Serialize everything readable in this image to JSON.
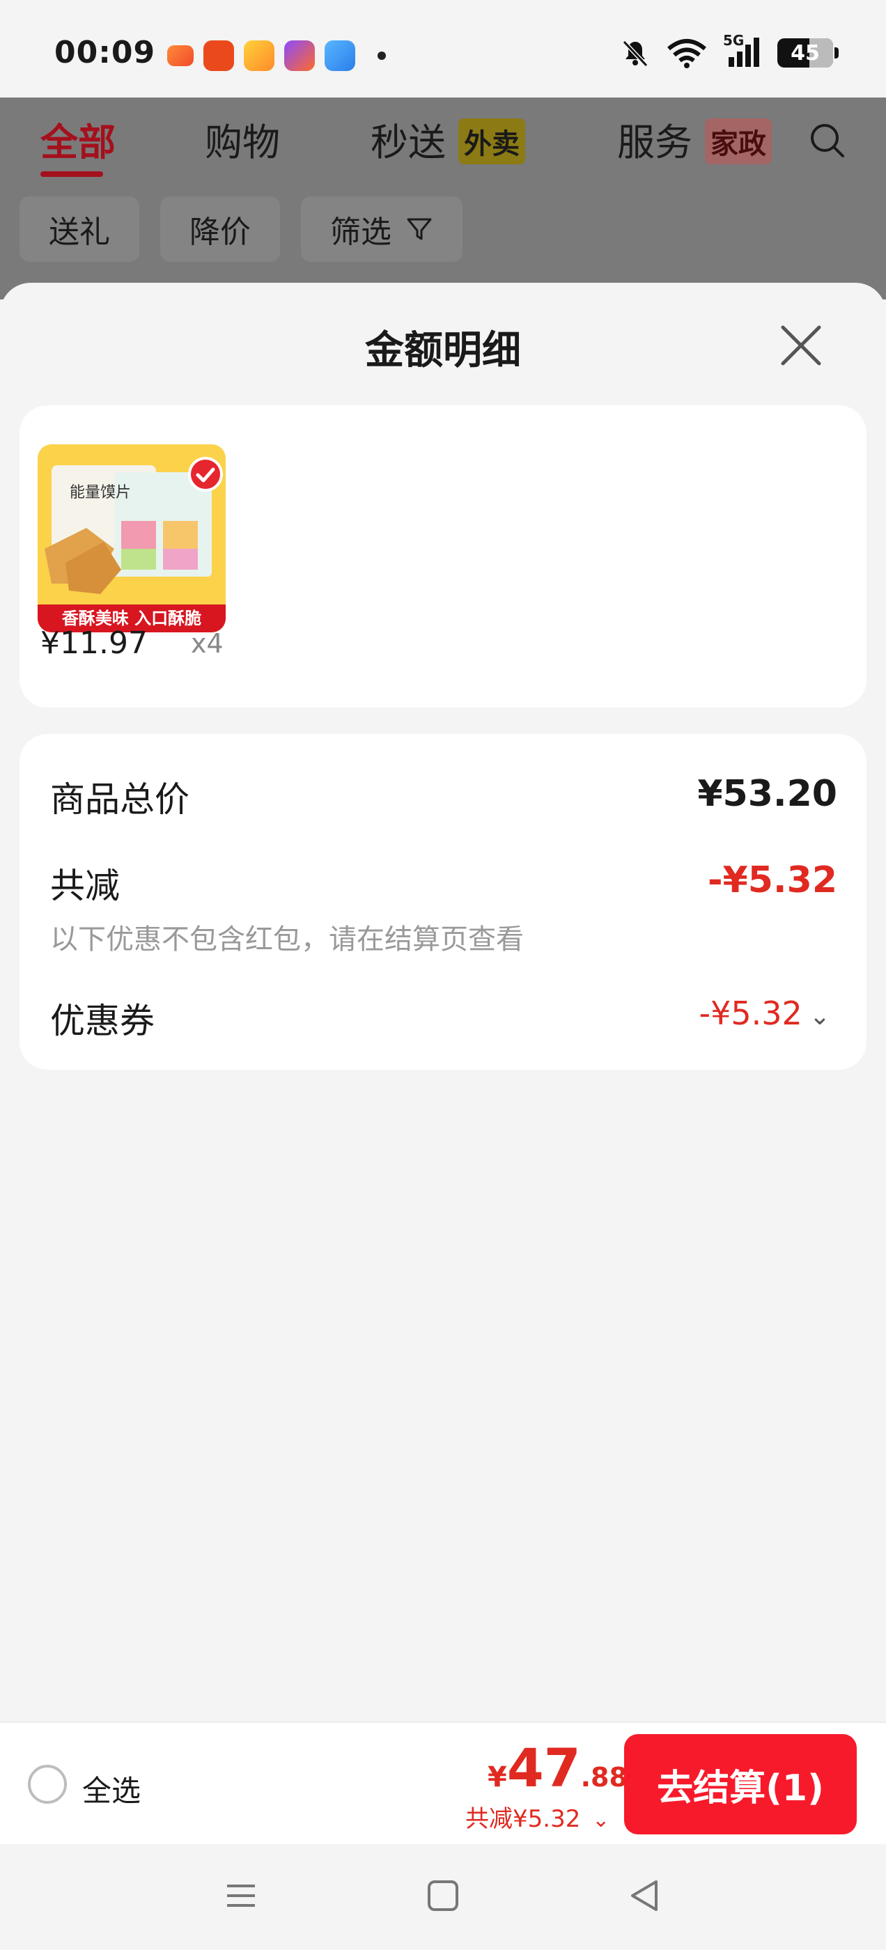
{
  "status_bar": {
    "time": "00:09",
    "network": "5G",
    "battery": "45"
  },
  "background_header": {
    "tabs": [
      {
        "label": "全部"
      },
      {
        "label": "购物"
      },
      {
        "label": "秒送",
        "badge": "外卖"
      },
      {
        "label": "服务",
        "badge": "家政"
      }
    ],
    "chips": [
      "送礼",
      "降价",
      "筛选"
    ]
  },
  "sheet": {
    "title": "金额明细",
    "product": {
      "image_caption": "香酥美味 入口酥脆",
      "image_brand": "能量馍片",
      "price": "¥11.97",
      "quantity": "x4"
    },
    "summary": {
      "total_label": "商品总价",
      "total_value": "¥53.20",
      "discount_label": "共减",
      "discount_value": "-¥5.32",
      "discount_note": "以下优惠不包含红包，请在结算页查看",
      "coupon_label": "优惠券",
      "coupon_value": "-¥5.32"
    }
  },
  "bottom_bar": {
    "select_all": "全选",
    "currency": "¥",
    "price_int": "47",
    "price_dec": ".88",
    "discount_text": "共减¥5.32",
    "checkout_label": "去结算(1)"
  },
  "colors": {
    "accent_red": "#e02a21",
    "checkout_button": "#f71a2b",
    "active_tab": "#a4101d"
  }
}
